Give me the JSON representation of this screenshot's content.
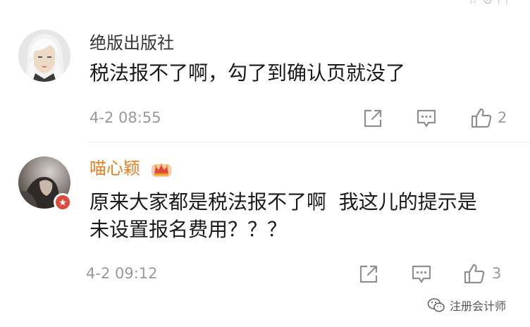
{
  "top_strip": {
    "faint_text": "☆ ⊙ □"
  },
  "comments": [
    {
      "username": "绝版出版社",
      "text": "税法报不了啊，勾了到确认页就没了",
      "timestamp": "4-2 08:55",
      "likes": "2",
      "avatar_icon": "anime-avatar"
    },
    {
      "username": "喵心颖",
      "username_color": "#ef7d1d",
      "vip_icon": "crown-icon",
      "text": "原来大家都是税法报不了啊  我这儿的提示是\n未设置报名费用？？？",
      "timestamp": "4-2 09:12",
      "likes": "3",
      "avatar_icon": "photo-avatar"
    }
  ],
  "watermark": {
    "label": "注册会计师",
    "icon": "wechat-icon"
  }
}
